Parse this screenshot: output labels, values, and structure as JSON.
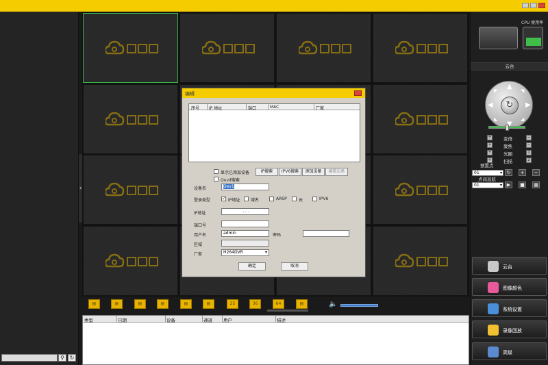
{
  "window": {
    "title": ""
  },
  "left": {
    "search_placeholder": "",
    "search_icon": "search-icon",
    "refresh_icon": "refresh-icon"
  },
  "grid": {
    "rows": 4,
    "cols": 4,
    "selected_index": 0
  },
  "layout_buttons": [
    "",
    "",
    "",
    "",
    "",
    "",
    "25",
    "36",
    "64",
    ""
  ],
  "log": {
    "columns": [
      "类型",
      "日期",
      "设备",
      "通道",
      "用户",
      "描述"
    ]
  },
  "right": {
    "cpu_label": "CPU 使用率",
    "ptz_title": "云台",
    "ptz_controls": [
      "变倍",
      "聚焦",
      "光圈",
      "扫描"
    ],
    "ptz_values": [
      "",
      "",
      "1",
      "2"
    ],
    "preset_label": "预置点",
    "preset_value": "01",
    "cruise_label": "点间巡航",
    "cruise_value": "01",
    "buttons": [
      {
        "label": "云台",
        "icon": "ptz-icon"
      },
      {
        "label": "图像颜色",
        "icon": "color-icon"
      },
      {
        "label": "系统设置",
        "icon": "settings-icon"
      },
      {
        "label": "录像回放",
        "icon": "playback-icon"
      },
      {
        "label": "高级",
        "icon": "advanced-icon"
      }
    ]
  },
  "dialog": {
    "title": "编辑",
    "columns": [
      "序号",
      "IP 地址",
      "端口",
      "MAC",
      "厂家"
    ],
    "show_added_label": "显示已添加设备",
    "onvif_label": "Onvif搜索",
    "btn_ip_search": "IP搜索",
    "btn_ipv6_search": "IPV6搜索",
    "btn_add": "添加设备",
    "btn_edit": "编辑设备",
    "device_name_label": "设备名",
    "device_name_value": "Dev1",
    "login_type_label": "登录类型",
    "login_types": [
      "IP地址",
      "域名",
      "ARSP",
      "云",
      "IPV6"
    ],
    "login_type_selected": "IP地址",
    "ip_label": "IP地址",
    "ip_value": ".   .   .",
    "port_label": "端口号",
    "port_value": "",
    "user_label": "用户名",
    "user_value": "admin",
    "password_label": "密码",
    "password_value": "",
    "region_label": "区域",
    "vendor_label": "厂家",
    "vendor_value": "H264DVR",
    "ok": "确定",
    "cancel": "取消"
  },
  "colors": {
    "accent": "#f5cc00",
    "selected_border": "#39b54a"
  }
}
